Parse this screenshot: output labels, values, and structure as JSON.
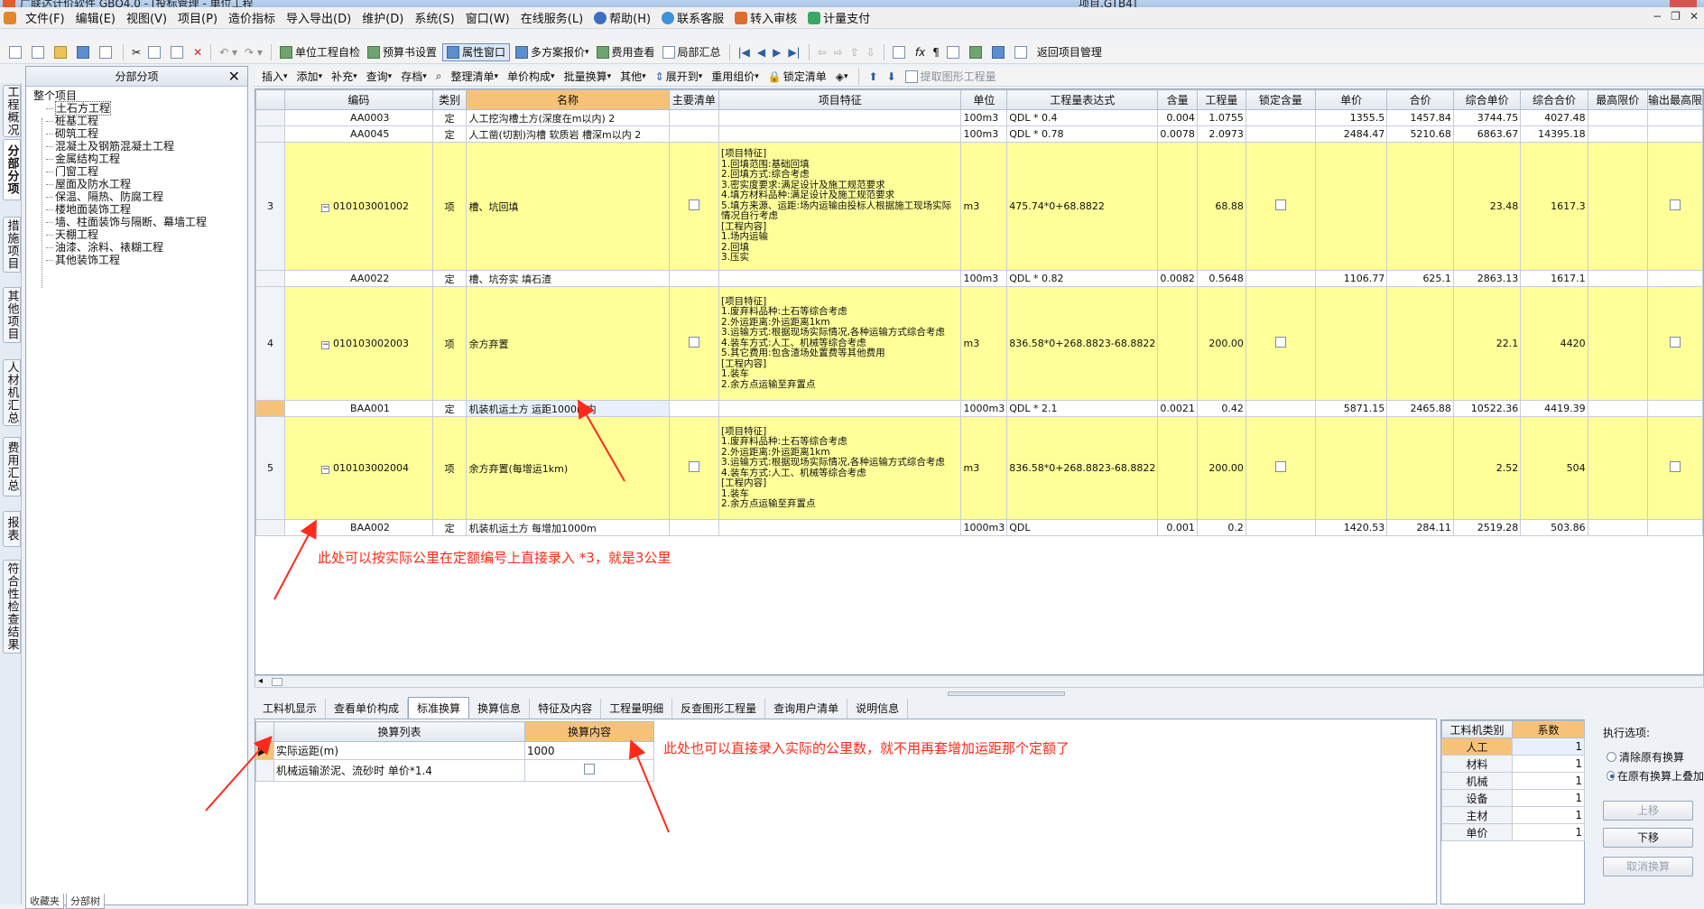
{
  "window": {
    "title_left": "广联达计价软件 GBQ4.0 - [投标管理 - 单位工程",
    "title_right": "项目.GTB4]"
  },
  "menu": [
    "文件(F)",
    "编辑(E)",
    "视图(V)",
    "项目(P)",
    "造价指标",
    "导入导出(D)",
    "维护(D)",
    "系统(S)",
    "窗口(W)",
    "在线服务(L)",
    "帮助(H)",
    "联系客服",
    "转入审核",
    "计量支付"
  ],
  "toolbar1": {
    "unit_check": "单位工程自检",
    "budget_setting": "预算书设置",
    "property_window": "属性窗口",
    "multi_plan": "多方案报价",
    "fee_view": "费用查看",
    "partial_summary": "局部汇总",
    "return_project": "返回项目管理"
  },
  "toolbar2": [
    "插入",
    "添加",
    "补充",
    "查询",
    "存档",
    "整理清单",
    "单价构成",
    "批量换算",
    "其他",
    "展开到",
    "重用组价",
    "锁定清单",
    "提取图形工程量"
  ],
  "left_vtabs": [
    "工程概况",
    "分部分项",
    "措施项目",
    "其他项目",
    "人材机汇总",
    "费用汇总",
    "报表",
    "符合性检查结果"
  ],
  "tree": {
    "header": "分部分项",
    "root": "整个项目",
    "items": [
      "土石方工程",
      "桩基工程",
      "砌筑工程",
      "混凝土及钢筋混凝土工程",
      "金属结构工程",
      "门窗工程",
      "屋面及防水工程",
      "保温、隔热、防腐工程",
      "楼地面装饰工程",
      "墙、柱面装饰与隔断、幕墙工程",
      "天棚工程",
      "油漆、涂料、裱糊工程",
      "其他装饰工程"
    ]
  },
  "bottom_tabs": [
    "收藏夹",
    "分部树"
  ],
  "grid": {
    "columns": [
      "编码",
      "类别",
      "名称",
      "主要清单",
      "项目特征",
      "单位",
      "工程量表达式",
      "含量",
      "工程量",
      "锁定含量",
      "单价",
      "合价",
      "综合单价",
      "综合合价",
      "最高限价",
      "输出最高限"
    ],
    "rows": [
      {
        "kind": "sub",
        "code": "AA0003",
        "type": "定",
        "name": "人工挖沟槽土方(深度在m以内) 2",
        "unit": "100m3",
        "expr": "QDL * 0.4",
        "content": "0.004",
        "qty": "1.0755",
        "price": "1355.5",
        "total": "1457.84",
        "uprice": "3744.75",
        "utotal": "4027.48"
      },
      {
        "kind": "sub",
        "code": "AA0045",
        "type": "定",
        "name": "人工凿(切割)沟槽 软质岩 槽深m以内 2",
        "unit": "100m3",
        "expr": "QDL * 0.78",
        "content": "0.0078",
        "qty": "2.0973",
        "price": "2484.47",
        "total": "5210.68",
        "uprice": "6863.67",
        "utotal": "14395.18"
      },
      {
        "kind": "item",
        "no": "3",
        "code": "010103001002",
        "type": "项",
        "name": "槽、坑回填",
        "feature": "[项目特征]\n1.回填范围:基础回填\n2.回填方式:综合考虑\n3.密实度要求:满足设计及施工规范要求\n4.填方材料品种:满足设计及施工规范要求\n5.填方来源、运距:场内运输由投标人根据施工现场实际情况自行考虑\n[工程内容]\n1.场内运输\n2.回填\n3.压实",
        "unit": "m3",
        "expr": "475.74*0+68.8822",
        "qty": "68.88",
        "uprice": "23.48",
        "utotal": "1617.3"
      },
      {
        "kind": "sub",
        "code": "AA0022",
        "type": "定",
        "name": "槽、坑夯实 填石渣",
        "unit": "100m3",
        "expr": "QDL * 0.82",
        "content": "0.0082",
        "qty": "0.5648",
        "price": "1106.77",
        "total": "625.1",
        "uprice": "2863.13",
        "utotal": "1617.1"
      },
      {
        "kind": "item",
        "no": "4",
        "code": "010103002003",
        "type": "项",
        "name": "余方弃置",
        "feature": "[项目特征]\n1.废弃料品种:土石等综合考虑\n2.外运距离:外运距离1km\n3.运输方式:根据现场实际情况,各种运输方式综合考虑\n4.装车方式:人工、机械等综合考虑\n5.其它费用:包含渣场处置费等其他费用\n[工程内容]\n1.装车\n2.余方点运输至弃置点",
        "unit": "m3",
        "expr": "836.58*0+268.8823-68.8822",
        "qty": "200.00",
        "uprice": "22.1",
        "utotal": "4420"
      },
      {
        "kind": "sub",
        "selected": true,
        "code": "BAA001",
        "type": "定",
        "name": "机装机运土方 运距1000m内",
        "unit": "1000m3",
        "expr": "QDL * 2.1",
        "content": "0.0021",
        "qty": "0.42",
        "price": "5871.15",
        "total": "2465.88",
        "uprice": "10522.36",
        "utotal": "4419.39"
      },
      {
        "kind": "item",
        "no": "5",
        "code": "010103002004",
        "type": "项",
        "name": "余方弃置(每增运1km)",
        "feature": "[项目特征]\n1.废弃料品种:土石等综合考虑\n2.外运距离:外运距离1km\n3.运输方式:根据现场实际情况,各种运输方式综合考虑\n4.装车方式:人工、机械等综合考虑\n[工程内容]\n1.装车\n2.余方点运输至弃置点",
        "unit": "m3",
        "expr": "836.58*0+268.8823-68.8822",
        "qty": "200.00",
        "uprice": "2.52",
        "utotal": "504"
      },
      {
        "kind": "sub",
        "code": "BAA002",
        "type": "定",
        "name": "机装机运土方 每增加1000m",
        "unit": "1000m3",
        "expr": "QDL",
        "content": "0.001",
        "qty": "0.2",
        "price": "1420.53",
        "total": "284.11",
        "uprice": "2519.28",
        "utotal": "503.86"
      }
    ]
  },
  "annotations": {
    "note1": "此处可以按实际公里在定额编号上直接录入 *3，就是3公里",
    "note2": "此处也可以直接录入实际的公里数，就不用再套增加运距那个定额了"
  },
  "detail_tabs": [
    "工料机显示",
    "查看单价构成",
    "标准换算",
    "换算信息",
    "特征及内容",
    "工程量明细",
    "反查图形工程量",
    "查询用户清单",
    "说明信息"
  ],
  "conversion": {
    "col_list": "换算列表",
    "col_content": "换算内容",
    "rows": [
      {
        "name": "实际运距(m)",
        "value": "1000"
      },
      {
        "name": "机械运输淤泥、流砂时 单价*1.4",
        "value": ""
      }
    ]
  },
  "coef": {
    "col_type": "工料机类别",
    "col_coef": "系数",
    "rows": [
      {
        "type": "人工",
        "coef": "1"
      },
      {
        "type": "材料",
        "coef": "1"
      },
      {
        "type": "机械",
        "coef": "1"
      },
      {
        "type": "设备",
        "coef": "1"
      },
      {
        "type": "主材",
        "coef": "1"
      },
      {
        "type": "单价",
        "coef": "1"
      }
    ]
  },
  "options": {
    "header": "执行选项:",
    "opt1": "清除原有换算",
    "opt2": "在原有换算上叠加",
    "btn_up": "上移",
    "btn_down": "下移",
    "btn_cancel": "取消换算"
  },
  "colors": {
    "highlight_row": "#ffff99",
    "header_active": "#f6c27a",
    "annotation": "#ff2a1a"
  }
}
